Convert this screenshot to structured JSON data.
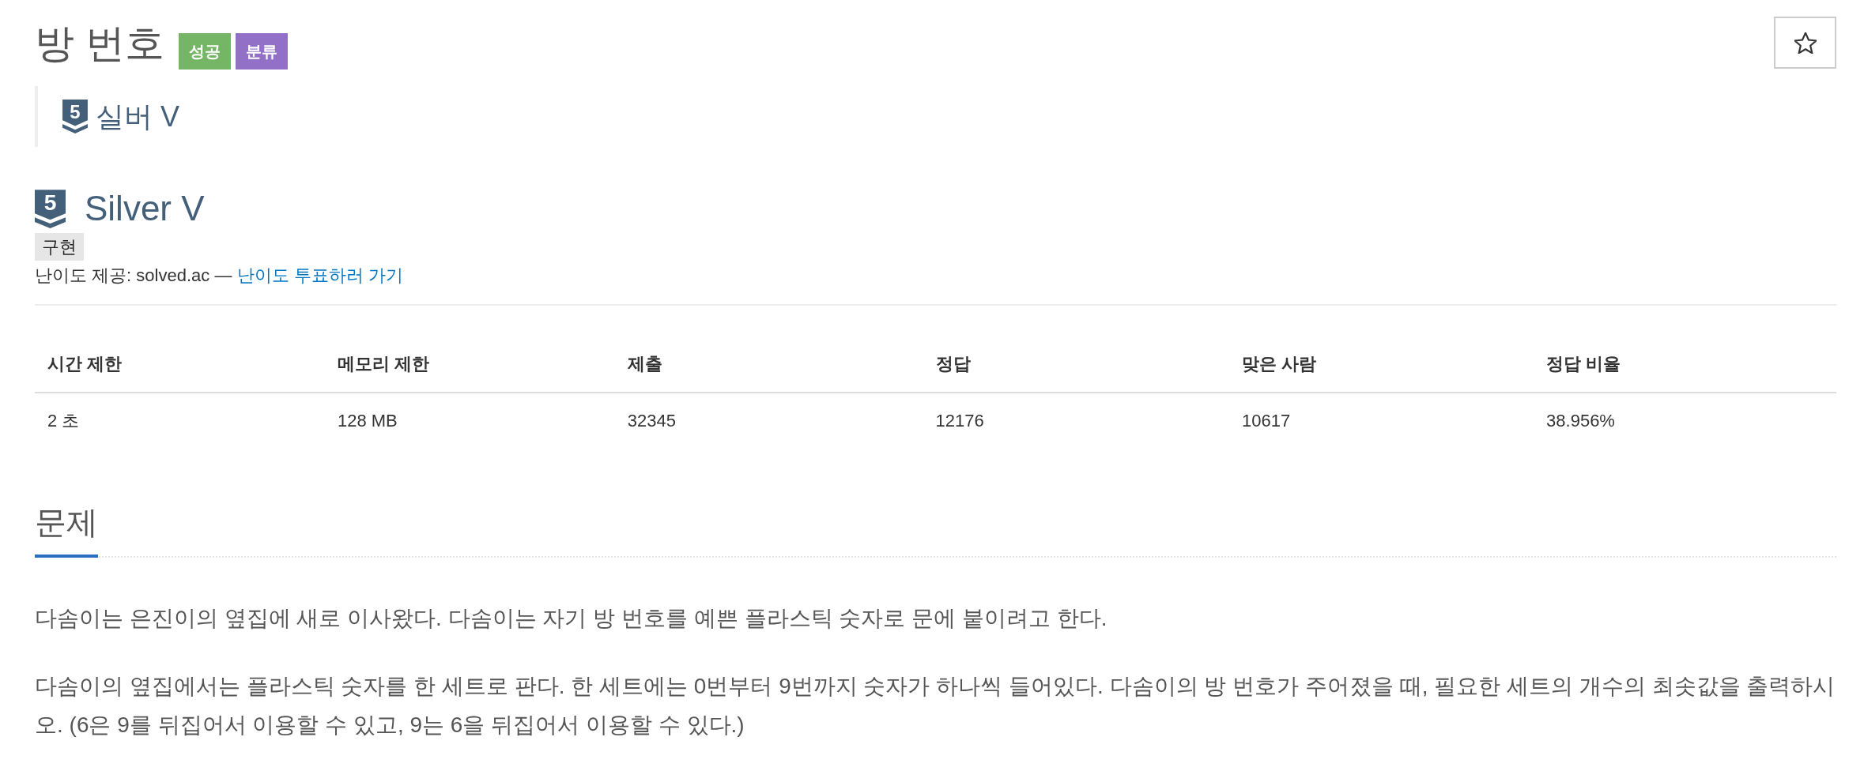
{
  "header": {
    "title": "방 번호",
    "badges": [
      {
        "label": "성공",
        "color": "#74b566"
      },
      {
        "label": "분류",
        "color": "#9370c8"
      }
    ],
    "favorite_button": {
      "starred": false
    }
  },
  "tier_quote": {
    "tier_number": "5",
    "label": "실버 V"
  },
  "tier_info": {
    "tier_number": "5",
    "label": "Silver V",
    "tags": [
      "구현"
    ],
    "credit": {
      "text": "난이도 제공: solved.ac —",
      "link": "난이도 투표하러 가기"
    }
  },
  "stats_table": {
    "columns": [
      "시간 제한",
      "메모리 제한",
      "제출",
      "정답",
      "맞은 사람",
      "정답 비율"
    ],
    "rows": [
      [
        "2 초",
        "128 MB",
        "32345",
        "12176",
        "10617",
        "38.956%"
      ]
    ]
  },
  "problem": {
    "heading": "문제",
    "paragraphs": [
      "다솜이는 은진이의 옆집에 새로 이사왔다. 다솜이는 자기 방 번호를 예쁜 플라스틱 숫자로 문에 붙이려고 한다.",
      "다솜이의 옆집에서는 플라스틱 숫자를 한 세트로 판다. 한 세트에는 0번부터 9번까지 숫자가 하나씩 들어있다. 다솜이의 방 번호가 주어졌을 때, 필요한 세트의 개수의 최솟값을 출력하시오. (6은 9를 뒤집어서 이용할 수 있고, 9는 6을 뒤집어서 이용할 수 있다.)"
    ]
  }
}
